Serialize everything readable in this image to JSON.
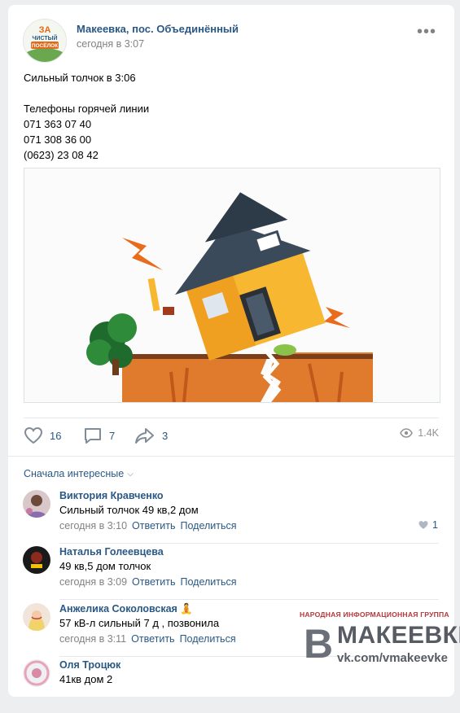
{
  "post": {
    "group_name": "Макеевка, пос. Объединённый",
    "time": "сегодня в 3:07",
    "avatar_text": "ЗА ЧИСТЫЙ ПОСЁЛОК",
    "text_lines": [
      "Сильный толчок в 3:06",
      "",
      "Телефоны горячей линии",
      "071 363 07 40",
      "071 308 36 00",
      "(0623) 23 08 42"
    ],
    "image": "illustration-house-earthquake",
    "likes": "16",
    "comments": "7",
    "shares": "3",
    "views": "1.4K"
  },
  "comments_section": {
    "sort_label": "Сначала интересные",
    "items": [
      {
        "name": "Виктория Кравченко",
        "text": "Сильный толчок 49 кв,2 дом",
        "time": "сегодня в 3:10",
        "reply": "Ответить",
        "share": "Поделиться",
        "likes": "1"
      },
      {
        "name": "Наталья Голеевцева",
        "text": "49 кв,5 дом толчок",
        "time": "сегодня в 3:09",
        "reply": "Ответить",
        "share": "Поделиться",
        "likes": ""
      },
      {
        "name": "Анжелика Соколовская 🧘",
        "text": "57 кВ-л сильный 7 д , позвонила",
        "time": "сегодня в 3:11",
        "reply": "Ответить",
        "share": "Поделиться",
        "likes": ""
      },
      {
        "name": "Оля Троцюк",
        "text": "41кв дом 2",
        "time": "",
        "reply": "",
        "share": "",
        "likes": ""
      }
    ]
  },
  "watermark": {
    "top": "НАРОДНАЯ ИНФОРМАЦИОННАЯ ГРУППА",
    "letter": "В",
    "big": "МАКЕЕВКЕ",
    "url": "vk.com/vmakeevke"
  },
  "colors": {
    "link": "#2a5885",
    "meta": "#828282",
    "background": "#edeef0"
  }
}
